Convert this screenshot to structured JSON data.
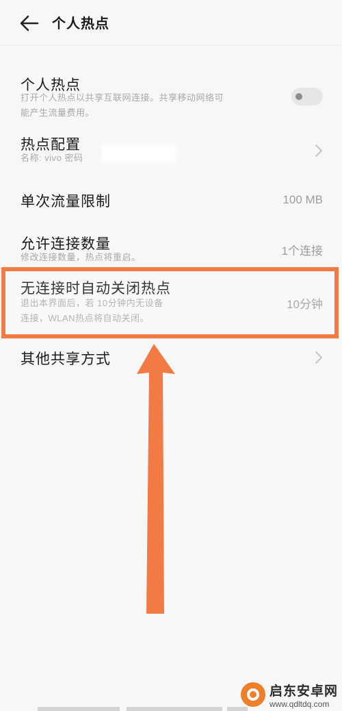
{
  "header": {
    "title": "个人热点"
  },
  "rows": [
    {
      "title": "个人热点",
      "subtitle_line1": "打开个人热点以共享互联网连接。共享移动网络可",
      "subtitle_line2": "能产生流量费用。",
      "toggle_state": "off"
    },
    {
      "title": "热点配置",
      "subtitle": "名称: vivo  密码"
    },
    {
      "title": "单次流量限制",
      "value": "100 MB"
    },
    {
      "title": "允许连接数量",
      "subtitle": "修改连接数量，热点将重启。",
      "value": "1个连接"
    },
    {
      "title": "无连接时自动关闭热点",
      "subtitle_line1": "退出本界面后，若 10分钟内无设备",
      "subtitle_line2": "连接，WLAN热点将自动关闭。",
      "value": "10分钟"
    },
    {
      "title": "其他共享方式"
    }
  ],
  "annotation": {
    "color": "#f27a45"
  },
  "watermark": {
    "name": "启东安卓网",
    "url": "www.qdltdq.com"
  }
}
